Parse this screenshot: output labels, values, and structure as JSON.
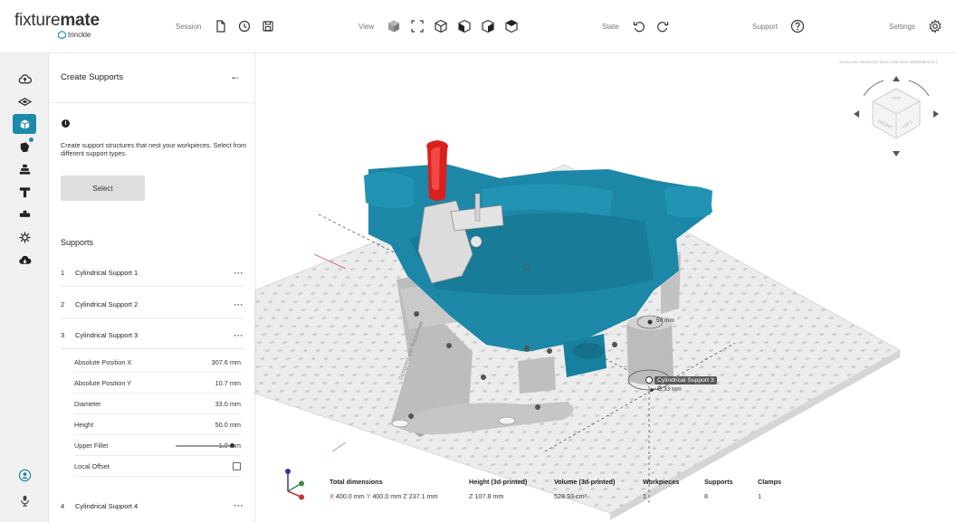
{
  "app": {
    "brand": "fixturemate",
    "brand_bold": "mate",
    "brand_light": "fixture",
    "sub_brand": "trinckle"
  },
  "header": {
    "session_label": "Session",
    "view_label": "View",
    "state_label": "State",
    "support_label": "Support",
    "settings_label": "Settings"
  },
  "panel": {
    "title": "Create Supports",
    "back_icon": "←",
    "description": "Create support structures that nest your workpieces. Select from different support types.",
    "select_label": "Select",
    "supports_heading": "Supports",
    "supports": [
      {
        "num": "1",
        "name": "Cylindrical Support 1",
        "more": "···"
      },
      {
        "num": "2",
        "name": "Cylindrical Support 2",
        "more": "···"
      },
      {
        "num": "3",
        "name": "Cylindrical Support 3",
        "more": "···"
      },
      {
        "num": "4",
        "name": "Cylindrical Support 4",
        "more": "···"
      }
    ],
    "properties": [
      {
        "label": "Absolute Position X",
        "value": "307.6 mm"
      },
      {
        "label": "Absolute Position Y",
        "value": "10.7 mm"
      },
      {
        "label": "Diameter",
        "value": "33.0 mm"
      },
      {
        "label": "Height",
        "value": "50.0 mm"
      },
      {
        "label": "Upper Fillet",
        "value": "1.0 mm",
        "slider_fraction": 1.0
      },
      {
        "label": "Local Offset",
        "checked": false
      }
    ]
  },
  "viewport": {
    "session_id": "SessionID: 85a0a131-9ba4-44f9-ad0b-9b0b0f9b1b4c1",
    "cube_labels": {
      "top": "TOP",
      "front": "FRONT",
      "left": "LEFT"
    },
    "callout_label": "Cylindrical Support 3",
    "callout_diameter": "Ø 33 mm",
    "callout_height": "50 mm",
    "engraving": "Designed with fixturemate"
  },
  "stats": {
    "total_dims_label": "Total dimensions",
    "total_x_axis": "X",
    "total_x": "400.0 mm",
    "total_y_axis": "Y",
    "total_y": "400.0 mm",
    "total_z_axis": "Z",
    "total_z": "237.1 mm",
    "height_label": "Height (3d-printed)",
    "height_axis": "Z",
    "height_value": "107.8 mm",
    "volume_label": "Volume (3d-printed)",
    "volume_value": "528.93 cm³",
    "workpieces_label": "Workpieces",
    "workpieces_value": "1",
    "supports_label": "Supports",
    "supports_value": "8",
    "clamps_label": "Clamps",
    "clamps_value": "1"
  },
  "colors": {
    "accent": "#1e8aa9",
    "workpiece": "#1b86a6",
    "printed_part": "#b9b9b9",
    "baseplate": "#e6e6e6",
    "handle": "#d9201c"
  }
}
